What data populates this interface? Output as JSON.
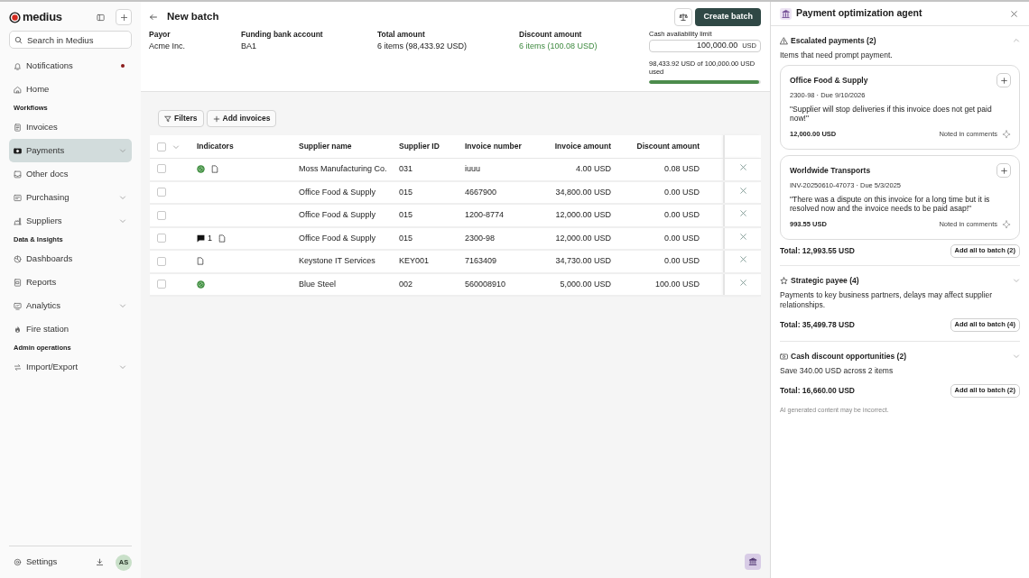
{
  "sidebar": {
    "logo": "medius",
    "search": {
      "placeholder": "Search in Medius"
    },
    "groups": [
      {
        "items": [
          {
            "label": "Notifications",
            "selected": false,
            "has_submenu": false,
            "unread": true
          },
          {
            "label": "Home",
            "selected": false,
            "has_submenu": false,
            "unread": false
          }
        ]
      },
      {
        "heading": "Workflows",
        "items": [
          {
            "label": "Invoices",
            "selected": false,
            "has_submenu": false,
            "unread": false
          },
          {
            "label": "Payments",
            "selected": true,
            "has_submenu": true,
            "unread": false
          },
          {
            "label": "Other docs",
            "selected": false,
            "has_submenu": false,
            "unread": false
          },
          {
            "label": "Purchasing",
            "selected": false,
            "has_submenu": true,
            "unread": false
          },
          {
            "label": "Suppliers",
            "selected": false,
            "has_submenu": true,
            "unread": false
          }
        ]
      },
      {
        "heading": "Data & Insights",
        "items": [
          {
            "label": "Dashboards",
            "selected": false,
            "has_submenu": false,
            "unread": false
          },
          {
            "label": "Reports",
            "selected": false,
            "has_submenu": false,
            "unread": false
          },
          {
            "label": "Analytics",
            "selected": false,
            "has_submenu": true,
            "unread": false
          },
          {
            "label": "Fire station",
            "selected": false,
            "has_submenu": false,
            "unread": false
          }
        ]
      },
      {
        "heading": "Admin operations",
        "items": [
          {
            "label": "Import/Export",
            "selected": false,
            "has_submenu": true,
            "unread": false
          }
        ]
      }
    ],
    "settings": "Settings",
    "avatar": "AS"
  },
  "header": {
    "title": "New batch",
    "create_button": "Create batch"
  },
  "summary": [
    {
      "label": "Payor",
      "value": "Acme Inc.",
      "positive": false
    },
    {
      "label": "Funding bank account",
      "value": "BA1",
      "positive": false
    },
    {
      "label": "Total amount",
      "value": "6 items (98,433.92 USD)",
      "positive": false
    },
    {
      "label": "Discount amount",
      "value": "6 items (100.08 USD)",
      "positive": true
    }
  ],
  "cash_limit": {
    "label": "Cash availability limit",
    "value": "100,000.00",
    "unit": "USD",
    "usage": "98,433.92 USD of 100,000.00 USD used",
    "level": 0.984
  },
  "toolbar": {
    "filters": "Filters",
    "add_invoices": "Add invoices"
  },
  "table": {
    "all_selected": false,
    "columns": [
      "Indicators",
      "Supplier name",
      "Supplier ID",
      "Invoice number",
      "Invoice amount",
      "Discount amount"
    ],
    "rows": [
      {
        "selected": false,
        "cells": [
          {
            "indicators": [
              {
                "kind": "discount"
              },
              {
                "kind": "document"
              }
            ]
          },
          "Moss Manufacturing Co.",
          "031",
          "iuuu",
          "4.00 USD",
          "0.08 USD"
        ]
      },
      {
        "selected": false,
        "cells": [
          "",
          "Office Food & Supply",
          "015",
          "4667900",
          "34,800.00 USD",
          "0.00 USD"
        ]
      },
      {
        "selected": false,
        "cells": [
          "",
          "Office Food & Supply",
          "015",
          "1200-8774",
          "12,000.00 USD",
          "0.00 USD"
        ]
      },
      {
        "selected": false,
        "cells": [
          {
            "indicators": [
              {
                "kind": "comment",
                "count": "1"
              },
              {
                "kind": "document"
              }
            ]
          },
          "Office Food & Supply",
          "015",
          "2300-98",
          "12,000.00 USD",
          "0.00 USD"
        ]
      },
      {
        "selected": false,
        "cells": [
          {
            "indicators": [
              {
                "kind": "document"
              }
            ]
          },
          "Keystone IT Services",
          "KEY001",
          "7163409",
          "34,730.00 USD",
          "0.00 USD"
        ]
      },
      {
        "selected": false,
        "cells": [
          {
            "indicators": [
              {
                "kind": "discount"
              }
            ]
          },
          "Blue Steel",
          "002",
          "560008910",
          "5,000.00 USD",
          "100.00 USD"
        ]
      }
    ]
  },
  "agent": {
    "title": "Payment optimization agent",
    "sections": [
      {
        "kind": "escalated",
        "title": "Escalated payments (2)",
        "expanded": true,
        "description": "Items that need prompt payment.",
        "cards": [
          {
            "supplier": "Office Food & Supply",
            "meta": "2300-98 · Due 9/10/2026",
            "quote": "\"Supplier will stop deliveries if this invoice does not get paid now!\"",
            "amount": "12,000.00 USD",
            "note": "Noted in comments"
          },
          {
            "supplier": "Worldwide Transports",
            "meta": "INV-20250610-47073 · Due 5/3/2025",
            "quote": "\"There was a dispute on this invoice for a long time but it is resolved now and the invoice needs to be paid asap!\"",
            "amount": "993.55 USD",
            "note": "Noted in comments"
          }
        ],
        "total": "Total: 12,993.55 USD",
        "action": "Add all to batch (2)"
      },
      {
        "kind": "strategic",
        "title": "Strategic payee (4)",
        "expanded": false,
        "description": "Payments to key business partners, delays may affect supplier relationships.",
        "total": "Total: 35,499.78 USD",
        "action": "Add all to batch (4)"
      },
      {
        "kind": "discount",
        "title": "Cash discount opportunities (2)",
        "expanded": false,
        "description": "Save 340.00 USD across 2 items",
        "total": "Total: 16,660.00 USD",
        "action": "Add all to batch (2)"
      }
    ],
    "disclaimer": "AI generated content may be incorrect."
  }
}
